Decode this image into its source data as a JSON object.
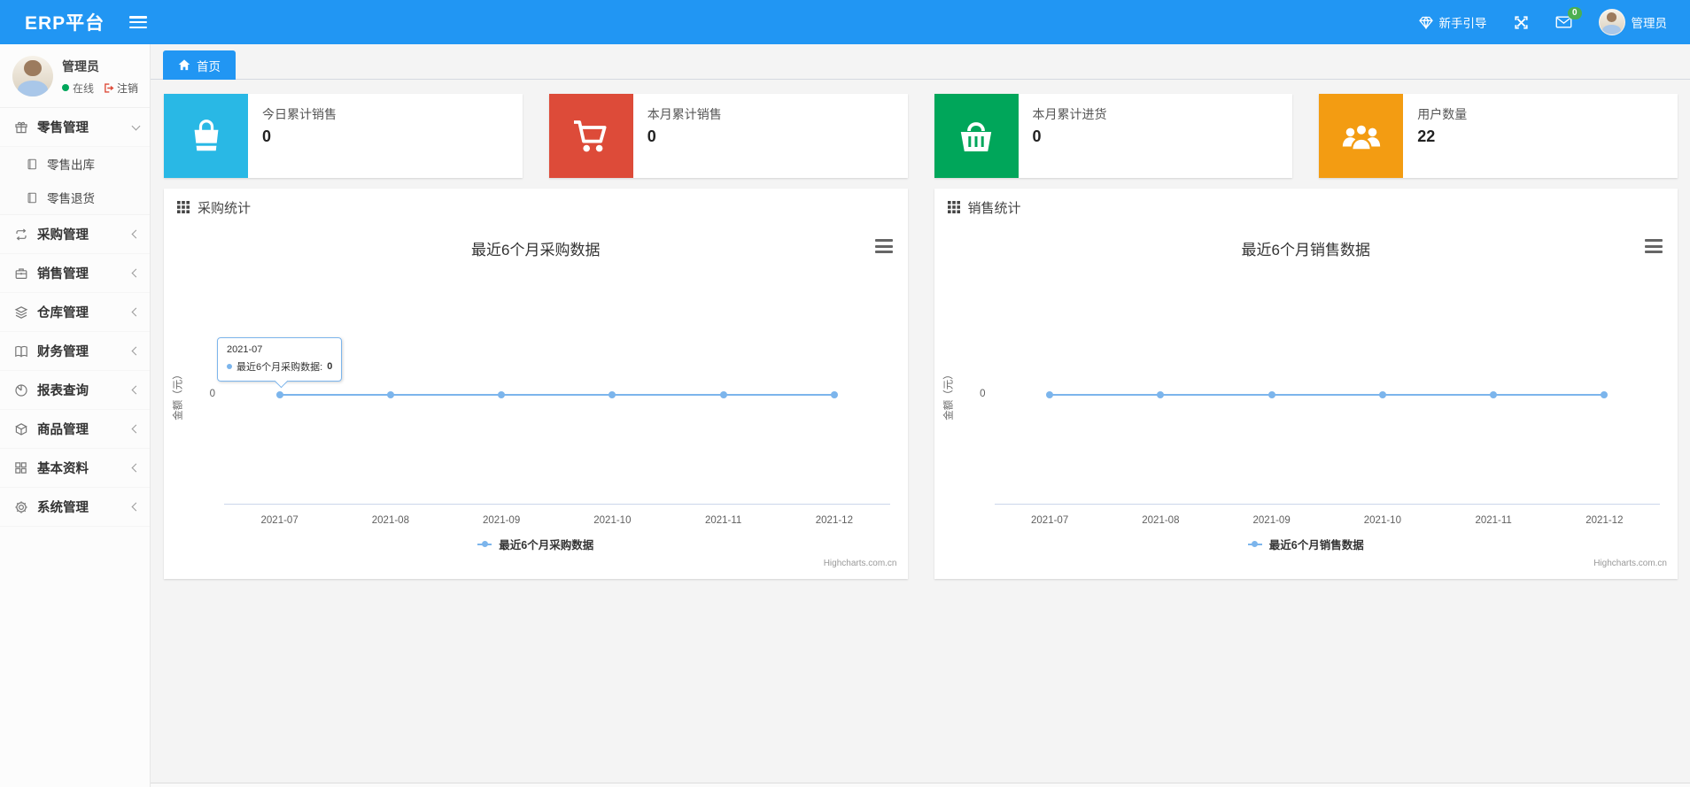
{
  "navbar": {
    "brand": "ERP平台",
    "guide_label": "新手引导",
    "message_badge": "0",
    "username": "管理员"
  },
  "sidebar": {
    "user": {
      "name": "管理员",
      "status_label": "在线",
      "logout_label": "注销"
    },
    "menu": [
      {
        "label": "零售管理",
        "icon": "gift-icon",
        "expanded": true,
        "children": [
          {
            "label": "零售出库",
            "icon": "journal-icon"
          },
          {
            "label": "零售退货",
            "icon": "journal-icon"
          }
        ]
      },
      {
        "label": "采购管理",
        "icon": "repeat-icon"
      },
      {
        "label": "销售管理",
        "icon": "briefcase-icon"
      },
      {
        "label": "仓库管理",
        "icon": "layers-icon"
      },
      {
        "label": "财务管理",
        "icon": "book-icon"
      },
      {
        "label": "报表查询",
        "icon": "pie-chart-icon"
      },
      {
        "label": "商品管理",
        "icon": "box-icon"
      },
      {
        "label": "基本资料",
        "icon": "grid-icon"
      },
      {
        "label": "系统管理",
        "icon": "gear-icon"
      }
    ]
  },
  "tabs": {
    "home_label": "首页"
  },
  "stat_cards": [
    {
      "label": "今日累计销售",
      "value": "0",
      "color": "#29b8e5",
      "icon": "shopping-bag-icon"
    },
    {
      "label": "本月累计销售",
      "value": "0",
      "color": "#dd4b39",
      "icon": "cart-icon"
    },
    {
      "label": "本月累计进货",
      "value": "0",
      "color": "#00a65a",
      "icon": "basket-icon"
    },
    {
      "label": "用户数量",
      "value": "22",
      "color": "#f39c12",
      "icon": "users-icon"
    }
  ],
  "panels": [
    {
      "title": "采购统计"
    },
    {
      "title": "销售统计"
    }
  ],
  "chart_data": [
    {
      "type": "line",
      "title": "最近6个月采购数据",
      "categories": [
        "2021-07",
        "2021-08",
        "2021-09",
        "2021-10",
        "2021-11",
        "2021-12"
      ],
      "series": [
        {
          "name": "最近6个月采购数据",
          "values": [
            0,
            0,
            0,
            0,
            0,
            0
          ],
          "color": "#7cb5ec"
        }
      ],
      "xlabel": "",
      "ylabel": "金额（元）",
      "yticks": [
        "0"
      ],
      "ylim": [
        -1,
        1
      ],
      "grid": false,
      "legend_position": "bottom",
      "credit": "Highcharts.com.cn",
      "tooltip": {
        "visible": true,
        "header": "2021-07",
        "label": "最近6个月采购数据:",
        "value": "0"
      }
    },
    {
      "type": "line",
      "title": "最近6个月销售数据",
      "categories": [
        "2021-07",
        "2021-08",
        "2021-09",
        "2021-10",
        "2021-11",
        "2021-12"
      ],
      "series": [
        {
          "name": "最近6个月销售数据",
          "values": [
            0,
            0,
            0,
            0,
            0,
            0
          ],
          "color": "#7cb5ec"
        }
      ],
      "xlabel": "",
      "ylabel": "金额（元）",
      "yticks": [
        "0"
      ],
      "ylim": [
        -1,
        1
      ],
      "grid": false,
      "legend_position": "bottom",
      "credit": "Highcharts.com.cn",
      "tooltip": {
        "visible": false
      }
    }
  ]
}
